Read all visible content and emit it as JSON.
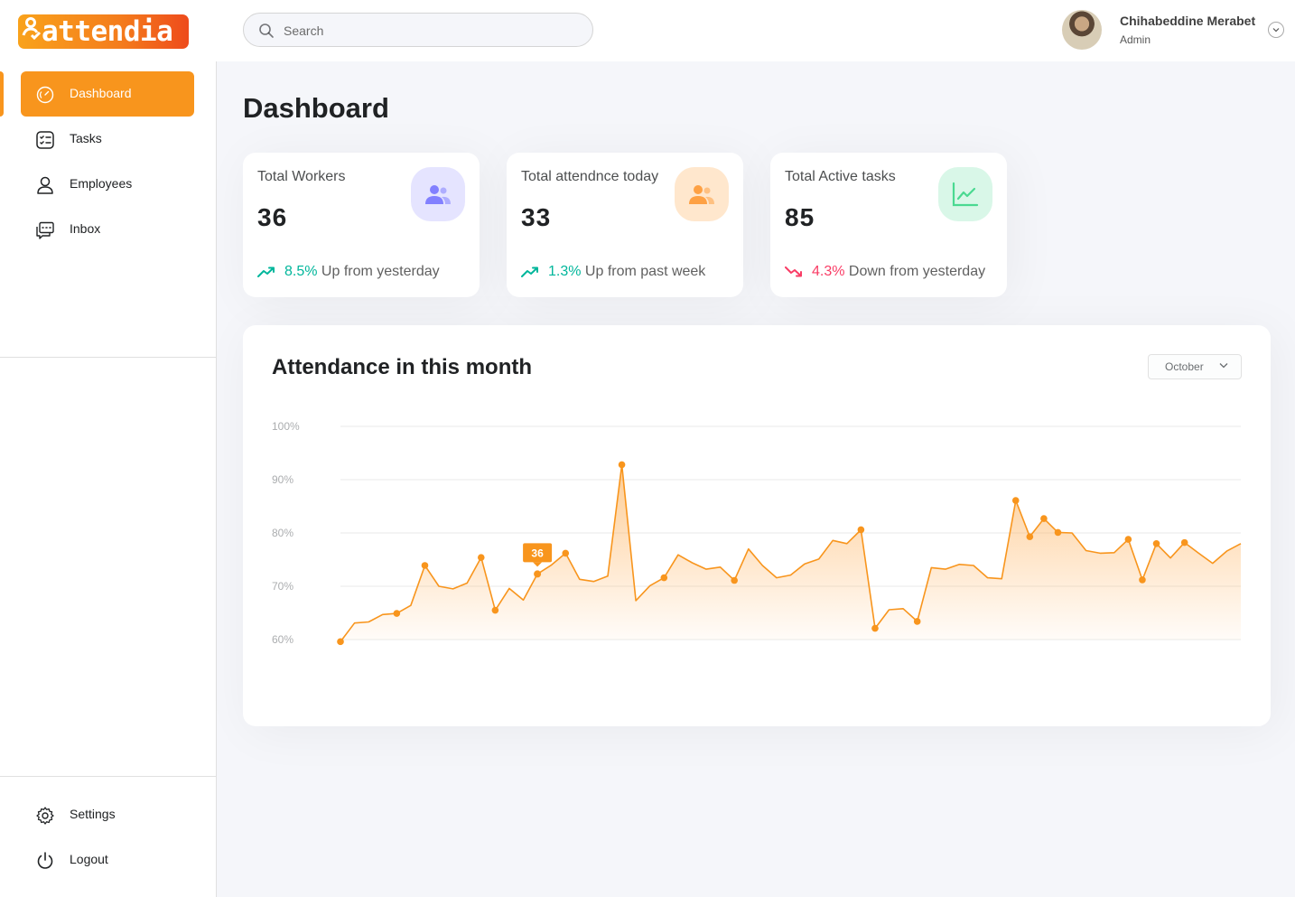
{
  "app": {
    "logo_text": "attendia"
  },
  "search": {
    "placeholder": "Search"
  },
  "user": {
    "name": "Chihabeddine Merabet",
    "role": "Admin"
  },
  "sidebar": {
    "items": [
      {
        "label": "Dashboard",
        "icon": "speedometer-icon",
        "active": true
      },
      {
        "label": "Tasks",
        "icon": "checklist-icon",
        "active": false
      },
      {
        "label": "Employees",
        "icon": "user-icon",
        "active": false
      },
      {
        "label": "Inbox",
        "icon": "chat-icon",
        "active": false
      }
    ],
    "bottom_items": [
      {
        "label": "Settings",
        "icon": "gear-icon"
      },
      {
        "label": "Logout",
        "icon": "power-icon"
      }
    ]
  },
  "page": {
    "title": "Dashboard"
  },
  "cards": [
    {
      "label": "Total Workers",
      "value": "36",
      "change": "8.5%",
      "change_text": "Up from yesterday",
      "direction": "up",
      "icon": "users-icon",
      "icon_color": "#8280ff",
      "icon_bg": "#e5e4ff"
    },
    {
      "label": "Total attendnce today",
      "value": "33",
      "change": "1.3%",
      "change_text": "Up from past week",
      "direction": "up",
      "icon": "users-icon",
      "icon_color": "#fea144",
      "icon_bg": "#ffe7cd"
    },
    {
      "label": "Total Active tasks",
      "value": "85",
      "change": "4.3%",
      "change_text": "Down from yesterday",
      "direction": "down",
      "icon": "line-chart-icon",
      "icon_color": "#4ad991",
      "icon_bg": "#d9f7e8"
    }
  ],
  "chart_card": {
    "title": "Attendance in this month",
    "month_select": "October"
  },
  "colors": {
    "accent": "#f8951d",
    "up": "#00b69b",
    "down": "#f93c65"
  },
  "chart_data": {
    "type": "area",
    "ylim": [
      60,
      100
    ],
    "yticks": [
      "100%",
      "90%",
      "80%",
      "70%",
      "60%"
    ],
    "grid": true,
    "highlight": {
      "index": 14,
      "label": "36"
    },
    "values": [
      59.6,
      63.1,
      63.3,
      64.7,
      64.9,
      66.4,
      73.9,
      70.0,
      69.5,
      70.6,
      75.4,
      65.5,
      69.6,
      67.4,
      72.3,
      74.0,
      76.2,
      71.3,
      70.9,
      71.9,
      92.8,
      67.3,
      70.1,
      71.6,
      75.9,
      74.4,
      73.2,
      73.6,
      71.1,
      77.0,
      73.9,
      71.6,
      72.1,
      74.2,
      75.1,
      78.6,
      78.0,
      80.6,
      62.1,
      65.6,
      65.8,
      63.4,
      73.5,
      73.2,
      74.1,
      73.9,
      71.6,
      71.4,
      86.1,
      79.3,
      82.7,
      80.1,
      80.0,
      76.7,
      76.2,
      76.3,
      78.8,
      71.2,
      78.0,
      75.3,
      78.2,
      76.2,
      74.3,
      76.6,
      78.0
    ],
    "marked_points": [
      0,
      4,
      6,
      10,
      11,
      16,
      20,
      23,
      28,
      37,
      38,
      41,
      48,
      49,
      50,
      51,
      56,
      57,
      58,
      60
    ]
  }
}
